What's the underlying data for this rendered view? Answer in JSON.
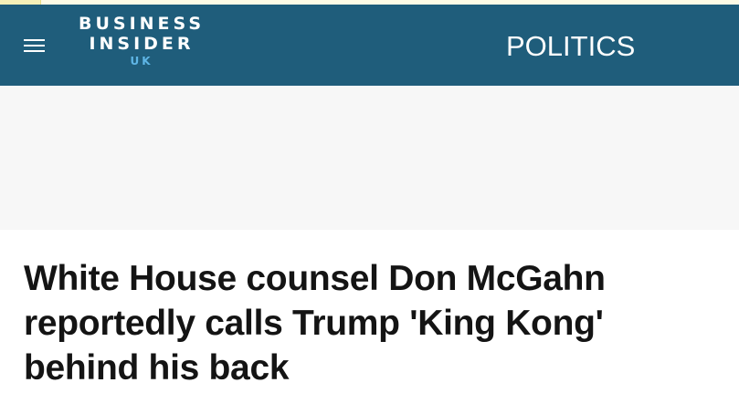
{
  "brand": {
    "line1": "BUSINESS",
    "line2": "INSIDER",
    "edition": "UK"
  },
  "header": {
    "section": "POLITICS",
    "menu_icon": "hamburger-menu-icon",
    "background_color": "#1f5d7b",
    "edition_color": "#5fb6e6"
  },
  "article": {
    "headline": "White House counsel Don McGahn reportedly calls Trump 'King Kong' behind his back"
  }
}
